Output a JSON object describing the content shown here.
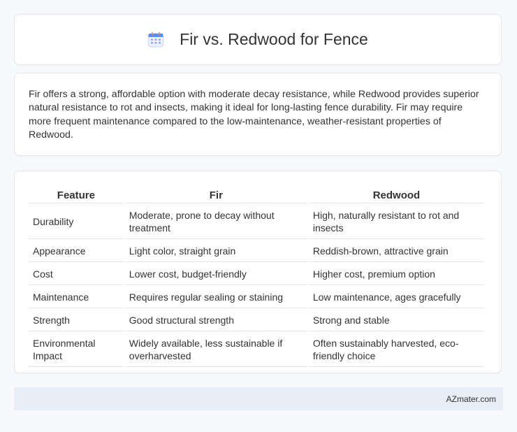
{
  "header": {
    "title": "Fir vs. Redwood for Fence",
    "icon": "calendar-icon",
    "icon_color": "#5b8def"
  },
  "summary": {
    "text": "Fir offers a strong, affordable option with moderate decay resistance, while Redwood provides superior natural resistance to rot and insects, making it ideal for long-lasting fence durability. Fir may require more frequent maintenance compared to the low-maintenance, weather-resistant properties of Redwood."
  },
  "table": {
    "headers": [
      "Feature",
      "Fir",
      "Redwood"
    ],
    "rows": [
      [
        "Durability",
        "Moderate, prone to decay without treatment",
        "High, naturally resistant to rot and insects"
      ],
      [
        "Appearance",
        "Light color, straight grain",
        "Reddish-brown, attractive grain"
      ],
      [
        "Cost",
        "Lower cost, budget-friendly",
        "Higher cost, premium option"
      ],
      [
        "Maintenance",
        "Requires regular sealing or staining",
        "Low maintenance, ages gracefully"
      ],
      [
        "Strength",
        "Good structural strength",
        "Strong and stable"
      ],
      [
        "Environmental Impact",
        "Widely available, less sustainable if overharvested",
        "Often sustainably harvested, eco-friendly choice"
      ]
    ]
  },
  "footer": {
    "brand": "AZmater.com",
    "background": "#e8eef8"
  }
}
